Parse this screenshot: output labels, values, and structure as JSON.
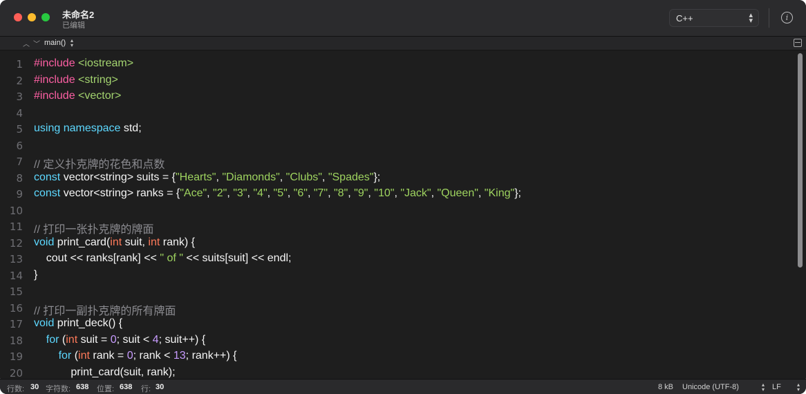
{
  "window": {
    "title": "未命名2",
    "subtitle": "已编辑"
  },
  "toolbar": {
    "language": "C++",
    "language_arrows": "⌃⌄"
  },
  "navbar": {
    "function": "main()"
  },
  "code": {
    "lines": [
      [
        {
          "t": "#include ",
          "c": "kw-inc"
        },
        {
          "t": "<iostream>",
          "c": "hdr"
        }
      ],
      [
        {
          "t": "#include ",
          "c": "kw-inc"
        },
        {
          "t": "<string>",
          "c": "hdr"
        }
      ],
      [
        {
          "t": "#include ",
          "c": "kw-inc"
        },
        {
          "t": "<vector>",
          "c": "hdr"
        }
      ],
      [],
      [
        {
          "t": "using namespace ",
          "c": "kw"
        },
        {
          "t": "std;",
          "c": ""
        }
      ],
      [],
      [
        {
          "t": "// 定义扑克牌的花色和点数",
          "c": "cmt"
        }
      ],
      [
        {
          "t": "const ",
          "c": "kw"
        },
        {
          "t": "vector<string> suits = {",
          "c": ""
        },
        {
          "t": "\"Hearts\"",
          "c": "strg"
        },
        {
          "t": ", ",
          "c": ""
        },
        {
          "t": "\"Diamonds\"",
          "c": "strg"
        },
        {
          "t": ", ",
          "c": ""
        },
        {
          "t": "\"Clubs\"",
          "c": "strg"
        },
        {
          "t": ", ",
          "c": ""
        },
        {
          "t": "\"Spades\"",
          "c": "strg"
        },
        {
          "t": "};",
          "c": ""
        }
      ],
      [
        {
          "t": "const ",
          "c": "kw"
        },
        {
          "t": "vector<string> ranks = {",
          "c": ""
        },
        {
          "t": "\"Ace\"",
          "c": "strg"
        },
        {
          "t": ", ",
          "c": ""
        },
        {
          "t": "\"2\"",
          "c": "strg"
        },
        {
          "t": ", ",
          "c": ""
        },
        {
          "t": "\"3\"",
          "c": "strg"
        },
        {
          "t": ", ",
          "c": ""
        },
        {
          "t": "\"4\"",
          "c": "strg"
        },
        {
          "t": ", ",
          "c": ""
        },
        {
          "t": "\"5\"",
          "c": "strg"
        },
        {
          "t": ", ",
          "c": ""
        },
        {
          "t": "\"6\"",
          "c": "strg"
        },
        {
          "t": ", ",
          "c": ""
        },
        {
          "t": "\"7\"",
          "c": "strg"
        },
        {
          "t": ", ",
          "c": ""
        },
        {
          "t": "\"8\"",
          "c": "strg"
        },
        {
          "t": ", ",
          "c": ""
        },
        {
          "t": "\"9\"",
          "c": "strg"
        },
        {
          "t": ", ",
          "c": ""
        },
        {
          "t": "\"10\"",
          "c": "strg"
        },
        {
          "t": ", ",
          "c": ""
        },
        {
          "t": "\"Jack\"",
          "c": "strg"
        },
        {
          "t": ", ",
          "c": ""
        },
        {
          "t": "\"Queen\"",
          "c": "strg"
        },
        {
          "t": ", ",
          "c": ""
        },
        {
          "t": "\"King\"",
          "c": "strg"
        },
        {
          "t": "};",
          "c": ""
        }
      ],
      [],
      [
        {
          "t": "// 打印一张扑克牌的牌面",
          "c": "cmt"
        }
      ],
      [
        {
          "t": "void ",
          "c": "kw"
        },
        {
          "t": "print_card(",
          "c": ""
        },
        {
          "t": "int ",
          "c": "type"
        },
        {
          "t": "suit, ",
          "c": ""
        },
        {
          "t": "int ",
          "c": "type"
        },
        {
          "t": "rank) {",
          "c": ""
        }
      ],
      [
        {
          "t": "    cout << ranks[rank] << ",
          "c": ""
        },
        {
          "t": "\" of \"",
          "c": "strg"
        },
        {
          "t": " << suits[suit] << endl;",
          "c": ""
        }
      ],
      [
        {
          "t": "}",
          "c": ""
        }
      ],
      [],
      [
        {
          "t": "// 打印一副扑克牌的所有牌面",
          "c": "cmt"
        }
      ],
      [
        {
          "t": "void ",
          "c": "kw"
        },
        {
          "t": "print_deck() {",
          "c": ""
        }
      ],
      [
        {
          "t": "    ",
          "c": ""
        },
        {
          "t": "for ",
          "c": "kw"
        },
        {
          "t": "(",
          "c": ""
        },
        {
          "t": "int ",
          "c": "type"
        },
        {
          "t": "suit = ",
          "c": ""
        },
        {
          "t": "0",
          "c": "num"
        },
        {
          "t": "; suit < ",
          "c": ""
        },
        {
          "t": "4",
          "c": "num"
        },
        {
          "t": "; suit++) {",
          "c": ""
        }
      ],
      [
        {
          "t": "        ",
          "c": ""
        },
        {
          "t": "for ",
          "c": "kw"
        },
        {
          "t": "(",
          "c": ""
        },
        {
          "t": "int ",
          "c": "type"
        },
        {
          "t": "rank = ",
          "c": ""
        },
        {
          "t": "0",
          "c": "num"
        },
        {
          "t": "; rank < ",
          "c": ""
        },
        {
          "t": "13",
          "c": "num"
        },
        {
          "t": "; rank++) {",
          "c": ""
        }
      ],
      [
        {
          "t": "            print_card(suit, rank);",
          "c": ""
        }
      ]
    ]
  },
  "status": {
    "lines_label": "行数:",
    "lines_value": "30",
    "chars_label": "字符数:",
    "chars_value": "638",
    "pos_label": "位置:",
    "pos_value": "638",
    "row_label": "行:",
    "row_value": "30",
    "size": "8 kB",
    "encoding": "Unicode (UTF-8)",
    "line_ending": "LF"
  }
}
